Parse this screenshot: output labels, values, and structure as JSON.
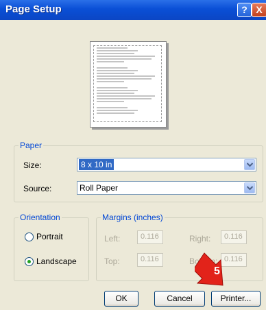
{
  "window": {
    "title": "Page Setup",
    "help_glyph": "?",
    "close_glyph": "X"
  },
  "paper": {
    "legend": "Paper",
    "size_label": "Size:",
    "size_value": "8 x 10 in",
    "source_label": "Source:",
    "source_value": "Roll Paper"
  },
  "orientation": {
    "legend": "Orientation",
    "portrait_label": "Portrait",
    "landscape_label": "Landscape",
    "selected": "landscape"
  },
  "margins": {
    "legend": "Margins (inches)",
    "left_label": "Left:",
    "left_value": "0.116",
    "right_label": "Right:",
    "right_value": "0.116",
    "top_label": "Top:",
    "top_value": "0.116",
    "bottom_label": "Bottom:",
    "bottom_value": "0.116"
  },
  "buttons": {
    "ok": "OK",
    "cancel": "Cancel",
    "printer": "Printer..."
  },
  "annotation": {
    "step": "5",
    "color": "#e2231a"
  }
}
